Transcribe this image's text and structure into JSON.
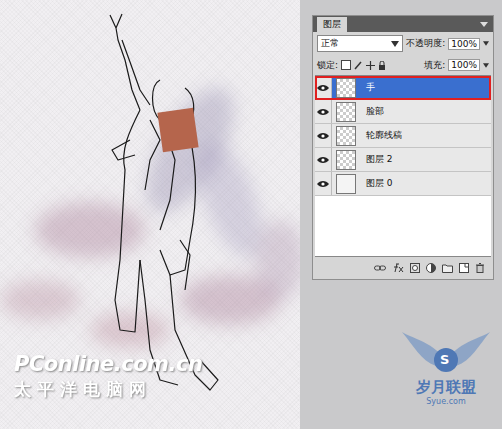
{
  "panel": {
    "title": "图层",
    "blend_mode": "正常",
    "opacity_label": "不透明度:",
    "opacity_value": "100%",
    "lock_label": "锁定:",
    "fill_label": "填充:",
    "fill_value": "100%"
  },
  "layers": [
    {
      "name": "手",
      "selected": true,
      "visible": true,
      "kind": "transparent"
    },
    {
      "name": "脸部",
      "selected": false,
      "visible": true,
      "kind": "transparent"
    },
    {
      "name": "轮廓线稿",
      "selected": false,
      "visible": true,
      "kind": "transparent"
    },
    {
      "name": "图层 2",
      "selected": false,
      "visible": true,
      "kind": "transparent"
    },
    {
      "name": "图层 0",
      "selected": false,
      "visible": true,
      "kind": "fill"
    }
  ],
  "watermarks": {
    "site": "PConline.com.cn",
    "site_cn": "太平洋电脑网",
    "logo_letter": "S",
    "logo_cn": "岁月联盟",
    "logo_url": "Syue.com"
  }
}
